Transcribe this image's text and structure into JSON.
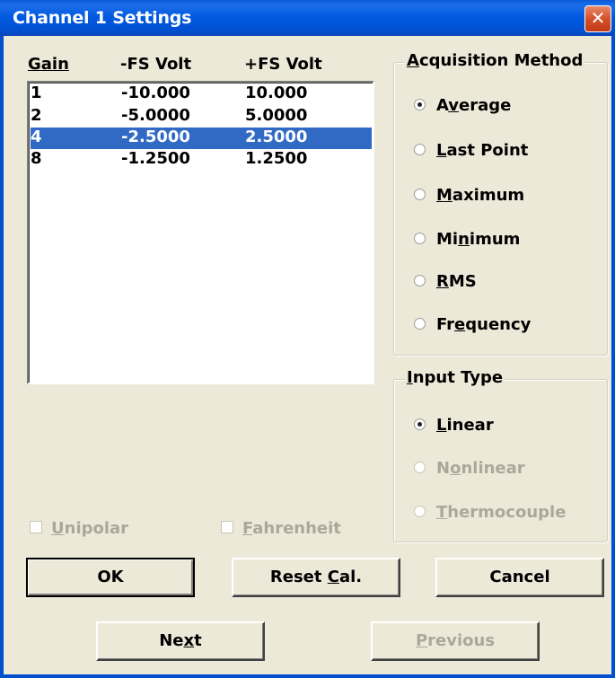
{
  "window": {
    "title": "Channel 1 Settings",
    "close_glyph": "✕"
  },
  "gain_table": {
    "headers": {
      "gain": "Gain",
      "neg_fs": "-FS Volt",
      "pos_fs": "+FS Volt"
    },
    "rows": [
      {
        "gain": "1",
        "neg": "-10.000",
        "pos": "10.000",
        "selected": false
      },
      {
        "gain": "2",
        "neg": "-5.0000",
        "pos": "5.0000",
        "selected": false
      },
      {
        "gain": "4",
        "neg": "-2.5000",
        "pos": "2.5000",
        "selected": true
      },
      {
        "gain": "8",
        "neg": "-1.2500",
        "pos": "1.2500",
        "selected": false
      }
    ]
  },
  "acquisition": {
    "label": "Acquisition Method",
    "options": [
      "Average",
      "Last Point",
      "Maximum",
      "Minimum",
      "RMS",
      "Frequency"
    ],
    "selected": "Average"
  },
  "input_type": {
    "label": "Input Type",
    "options": [
      "Linear",
      "Nonlinear",
      "Thermocouple"
    ],
    "selected": "Linear"
  },
  "checkboxes": {
    "unipolar": "Unipolar",
    "fahrenheit": "Fahrenheit"
  },
  "buttons": {
    "ok": "OK",
    "reset_cal": "Reset Cal.",
    "cancel": "Cancel",
    "next": "Next",
    "previous": "Previous"
  },
  "colors": {
    "titlebar": "#0058E0",
    "selection": "#316AC5",
    "face": "#ECE9D8",
    "disabled_text": "#ACA899"
  }
}
